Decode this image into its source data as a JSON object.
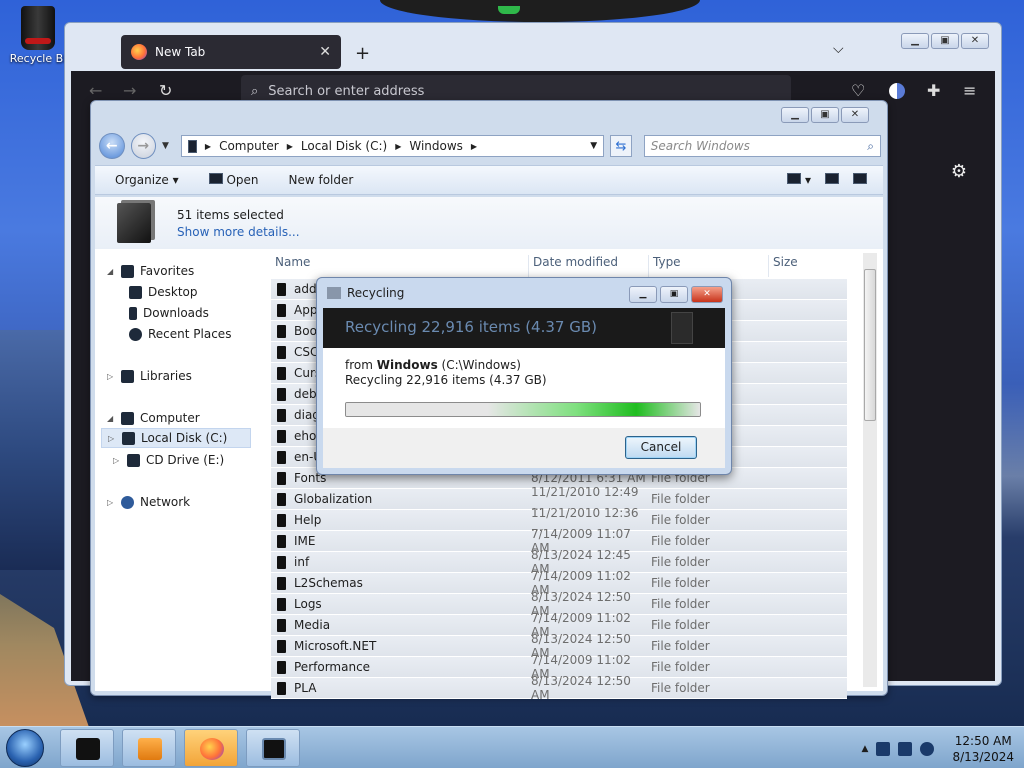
{
  "desktop": {
    "recycle_bin_label": "Recycle Bi"
  },
  "firefox": {
    "tab_title": "New Tab",
    "tab_close": "✕",
    "new_tab_button": "+",
    "list_all_tabs": "⌵",
    "url_placeholder": "Search or enter address",
    "back": "←",
    "forward": "→",
    "reload": "↻",
    "menu": "≡",
    "settings_icon": "⚙"
  },
  "explorer": {
    "breadcrumb": [
      "Computer",
      "Local Disk (C:)",
      "Windows"
    ],
    "search_placeholder": "Search Windows",
    "toolbar": {
      "organize": "Organize ▾",
      "open": "Open",
      "new_folder": "New folder"
    },
    "details": {
      "selection": "51 items selected",
      "more": "Show more details..."
    },
    "nav": {
      "favorites": "Favorites",
      "desktop": "Desktop",
      "downloads": "Downloads",
      "recent": "Recent Places",
      "libraries": "Libraries",
      "computer": "Computer",
      "local_disk": "Local Disk (C:)",
      "cd_drive": "CD Drive (E:)",
      "network": "Network"
    },
    "columns": {
      "name": "Name",
      "date": "Date modified",
      "type": "Type",
      "size": "Size"
    },
    "rows": [
      {
        "name": "add",
        "date": "",
        "type": ""
      },
      {
        "name": "App",
        "date": "",
        "type": ""
      },
      {
        "name": "Boo",
        "date": "",
        "type": ""
      },
      {
        "name": "CSC",
        "date": "",
        "type": ""
      },
      {
        "name": "Curs",
        "date": "",
        "type": ""
      },
      {
        "name": "deb",
        "date": "",
        "type": ""
      },
      {
        "name": "diag",
        "date": "",
        "type": ""
      },
      {
        "name": "eho",
        "date": "",
        "type": ""
      },
      {
        "name": "en-U",
        "date": "",
        "type": ""
      },
      {
        "name": "Fonts",
        "date": "8/12/2011 6:31 AM",
        "type": "File folder"
      },
      {
        "name": "Globalization",
        "date": "11/21/2010 12:49 ...",
        "type": "File folder"
      },
      {
        "name": "Help",
        "date": "11/21/2010 12:36 ...",
        "type": "File folder"
      },
      {
        "name": "IME",
        "date": "7/14/2009 11:07 AM",
        "type": "File folder"
      },
      {
        "name": "inf",
        "date": "8/13/2024 12:45 AM",
        "type": "File folder"
      },
      {
        "name": "L2Schemas",
        "date": "7/14/2009 11:02 AM",
        "type": "File folder"
      },
      {
        "name": "Logs",
        "date": "8/13/2024 12:50 AM",
        "type": "File folder"
      },
      {
        "name": "Media",
        "date": "7/14/2009 11:02 AM",
        "type": "File folder"
      },
      {
        "name": "Microsoft.NET",
        "date": "8/13/2024 12:50 AM",
        "type": "File folder"
      },
      {
        "name": "Performance",
        "date": "7/14/2009 11:02 AM",
        "type": "File folder"
      },
      {
        "name": "PLA",
        "date": "8/13/2024 12:50 AM",
        "type": "File folder"
      }
    ]
  },
  "dialog": {
    "title": "Recycling",
    "banner": "Recycling 22,916 items (4.37 GB)",
    "from_prefix": "from ",
    "from_bold": "Windows",
    "from_path": " (C:\\Windows)",
    "status": "Recycling 22,916 items (4.37 GB)",
    "cancel": "Cancel"
  },
  "taskbar": {
    "time": "12:50 AM",
    "date": "8/13/2024",
    "tray_arrow": "▲"
  }
}
